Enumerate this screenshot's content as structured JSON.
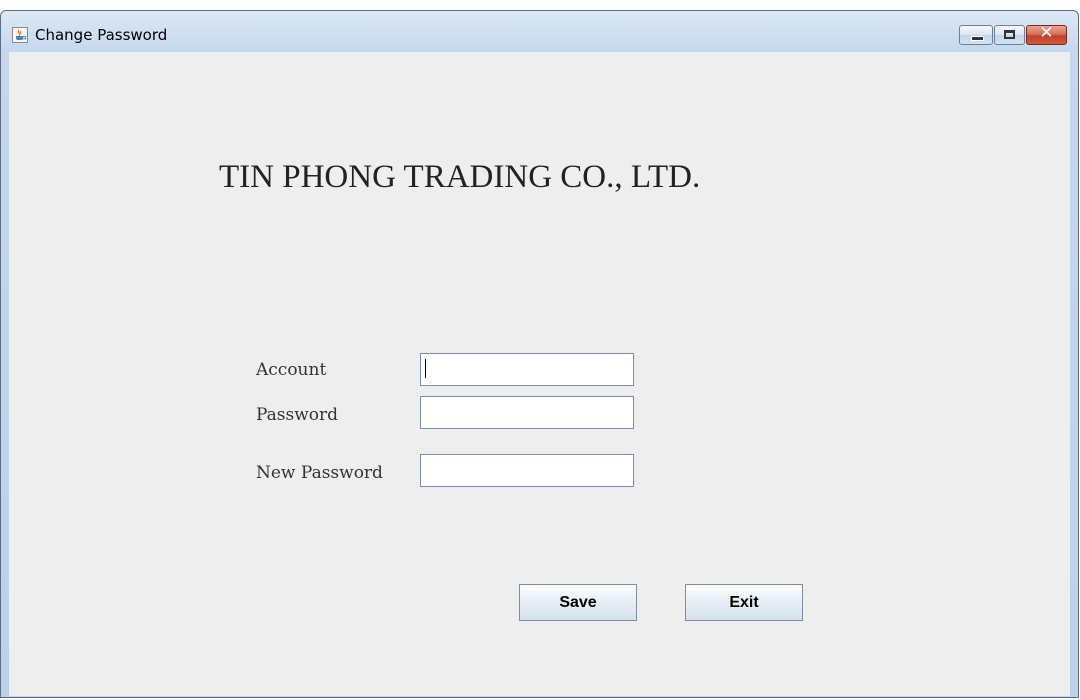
{
  "window": {
    "title": "Change Password",
    "close_glyph": "✕"
  },
  "header": {
    "company_name": "TIN PHONG TRADING CO., LTD."
  },
  "form": {
    "account_label": "Account",
    "account_value": "",
    "password_label": "Password",
    "password_value": "",
    "new_password_label": "New Password",
    "new_password_value": ""
  },
  "actions": {
    "save_label": "Save",
    "exit_label": "Exit"
  },
  "icons": {
    "app": "java-cup-icon",
    "minimize": "minimize-icon",
    "maximize": "maximize-icon",
    "close": "close-icon"
  }
}
